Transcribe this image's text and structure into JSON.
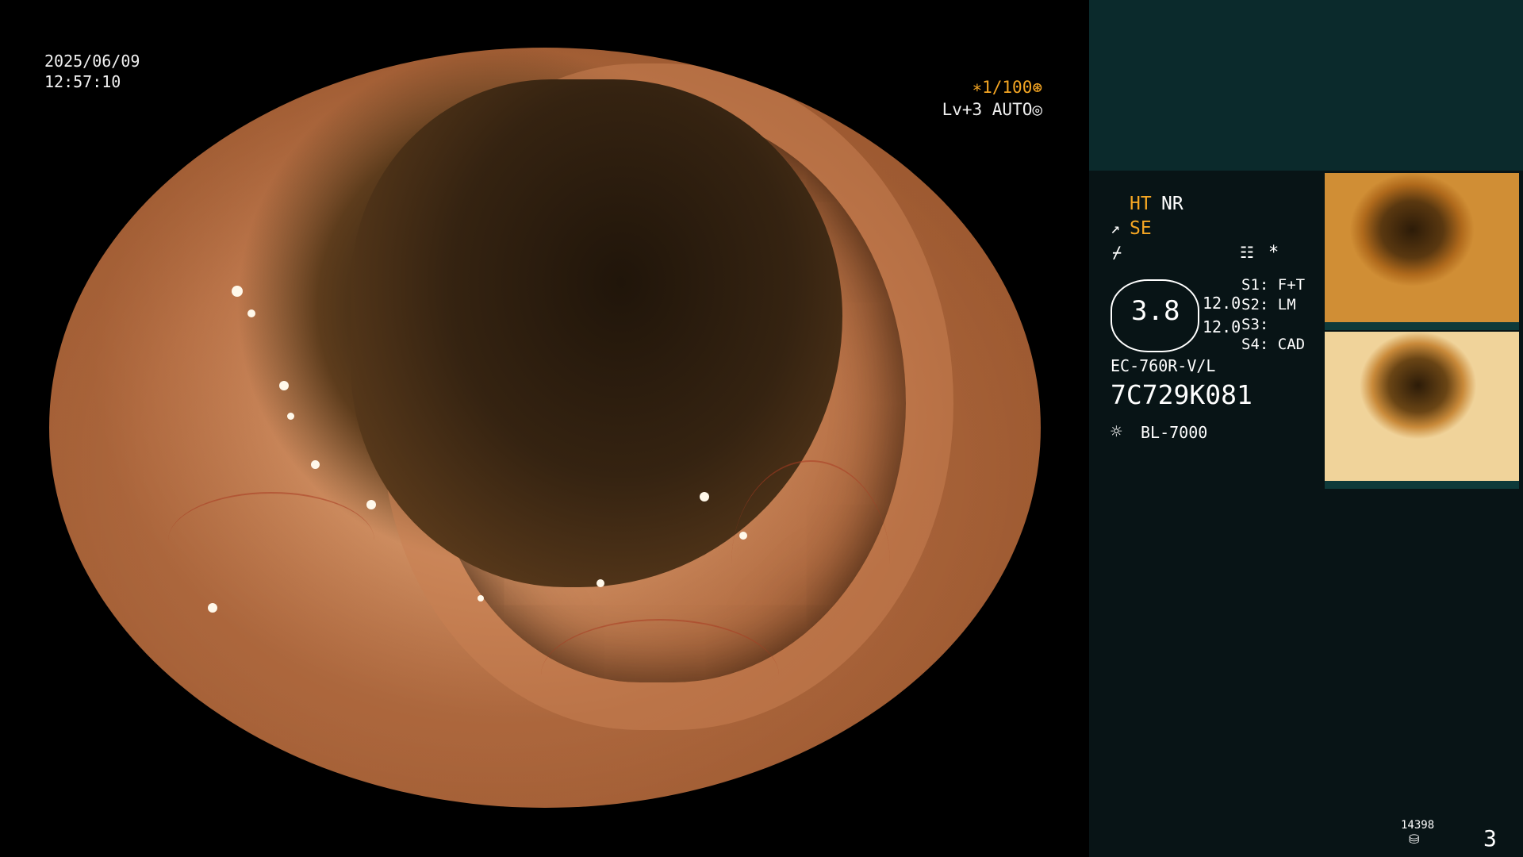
{
  "overlay": {
    "date": "2025/06/09",
    "time": "12:57:10",
    "shutter": "∗1/100⊛",
    "iris": "Lv+3 AUTO◎"
  },
  "panel": {
    "mode_ht": "HT",
    "mode_nr": "NR",
    "mode_se": "SE",
    "zoom": "3.8",
    "val1": "12.0",
    "val2": "12.0",
    "s1": "S1: F+T",
    "s2": "S2: LM",
    "s3": "S3:",
    "s4": "S4: CAD",
    "scope_model": "EC-760R-V/L",
    "serial": "7C729K081",
    "light_source": "BL-7000",
    "count": "14398",
    "page": "3"
  },
  "colors": {
    "accent": "#f5a623",
    "panel_bg": "#081416",
    "panel_top": "#0b2a2c"
  }
}
